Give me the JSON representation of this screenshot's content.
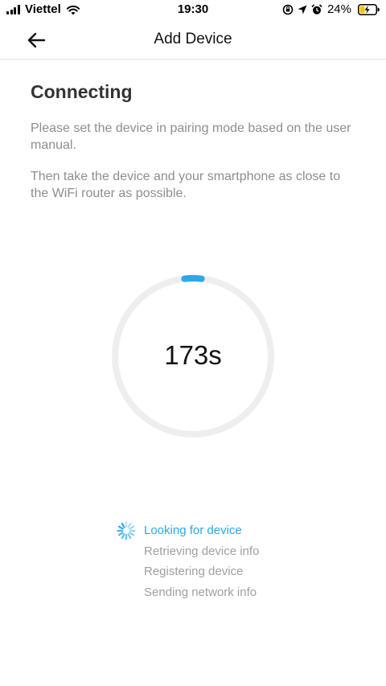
{
  "status_bar": {
    "carrier": "Viettel",
    "time": "19:30",
    "battery_percent": "24%",
    "icons": [
      "signal-bars-icon",
      "wifi-icon",
      "screen-lock-rotation-icon",
      "location-arrow-icon",
      "alarm-clock-icon",
      "battery-charging-icon"
    ],
    "battery_color": "#f5c400"
  },
  "nav": {
    "title": "Add Device",
    "back_icon": "back-arrow-icon"
  },
  "main": {
    "heading": "Connecting",
    "instruction_1": "Please set the device in pairing mode based on the user manual.",
    "instruction_2": "Then take the device and your smartphone as close to the WiFi router as possible.",
    "countdown": "173s",
    "progress_fraction": 0.035
  },
  "steps": [
    {
      "label": "Looking for device",
      "state": "active"
    },
    {
      "label": "Retrieving device info",
      "state": "pending"
    },
    {
      "label": "Registering device",
      "state": "pending"
    },
    {
      "label": "Sending network info",
      "state": "pending"
    }
  ],
  "colors": {
    "accent": "#2ea8e5",
    "ring_track": "#eeeeee",
    "muted_text": "#8e8e8e"
  }
}
